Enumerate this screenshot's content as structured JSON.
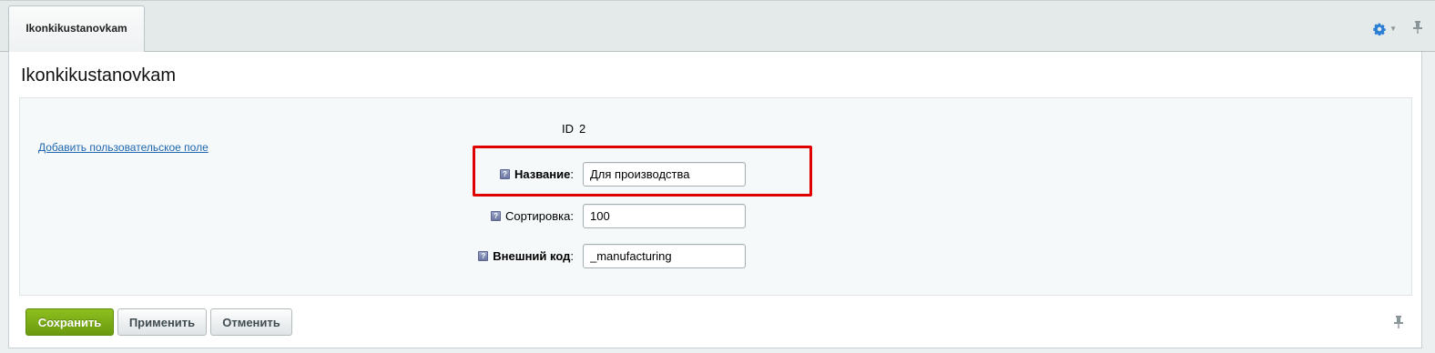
{
  "tab": {
    "label": "Ikonkikustanovkam"
  },
  "toolbar": {
    "settings_icon": "gear-icon",
    "pin_icon": "pin-icon"
  },
  "page": {
    "title": "Ikonkikustanovkam"
  },
  "form": {
    "add_field_link": "Добавить пользовательское поле",
    "id_label": "ID",
    "id_value": "2",
    "help_glyph": "?",
    "fields": [
      {
        "label": "Название",
        "colon": ":",
        "value": "Для производства",
        "bold": true
      },
      {
        "label": "Сортировка",
        "colon": ":",
        "value": "100",
        "bold": false
      },
      {
        "label": "Внешний код",
        "colon": ":",
        "value": "_manufacturing",
        "bold": true
      }
    ]
  },
  "buttons": {
    "save": "Сохранить",
    "apply": "Применить",
    "cancel": "Отменить"
  },
  "colors": {
    "accent_green": "#7aac14",
    "highlight_red": "#e00000",
    "link_blue": "#2067b0"
  }
}
